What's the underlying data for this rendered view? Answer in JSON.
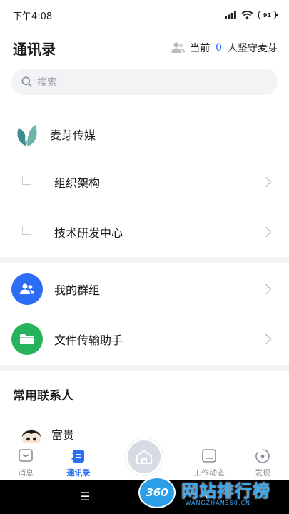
{
  "status_bar": {
    "time": "下午4:08",
    "battery": "91"
  },
  "header": {
    "title": "通讯录",
    "online_prefix": "当前",
    "online_count": "0",
    "online_suffix": "人坚守麦芽"
  },
  "search": {
    "placeholder": "搜索"
  },
  "org": {
    "name": "麦芽传媒"
  },
  "tree_items": [
    {
      "label": "组织架构"
    },
    {
      "label": "技术研发中心"
    }
  ],
  "features": [
    {
      "label": "我的群组",
      "color": "#2b6ef5",
      "icon": "people-icon"
    },
    {
      "label": "文件传输助手",
      "color": "#27b35b",
      "icon": "folder-icon"
    }
  ],
  "frequent": {
    "title": "常用联系人",
    "contacts": [
      {
        "name": "富贵"
      }
    ]
  },
  "tabs": [
    {
      "label": "消息",
      "icon": "message-icon",
      "active": false
    },
    {
      "label": "通讯录",
      "icon": "contacts-icon",
      "active": true
    },
    {
      "label": "工作动态",
      "icon": "work-icon",
      "active": false
    },
    {
      "label": "发现",
      "icon": "discover-icon",
      "active": false
    }
  ],
  "navbar": {
    "menu_glyph": "☰",
    "back_glyph": "‹"
  },
  "watermark": {
    "logo": "360",
    "text": "网站排行榜",
    "sub": "·WANGZHAN360.CN·"
  },
  "colors": {
    "accent": "#2b6ef5",
    "green": "#27b35b",
    "divider": "#f2f3f5"
  }
}
